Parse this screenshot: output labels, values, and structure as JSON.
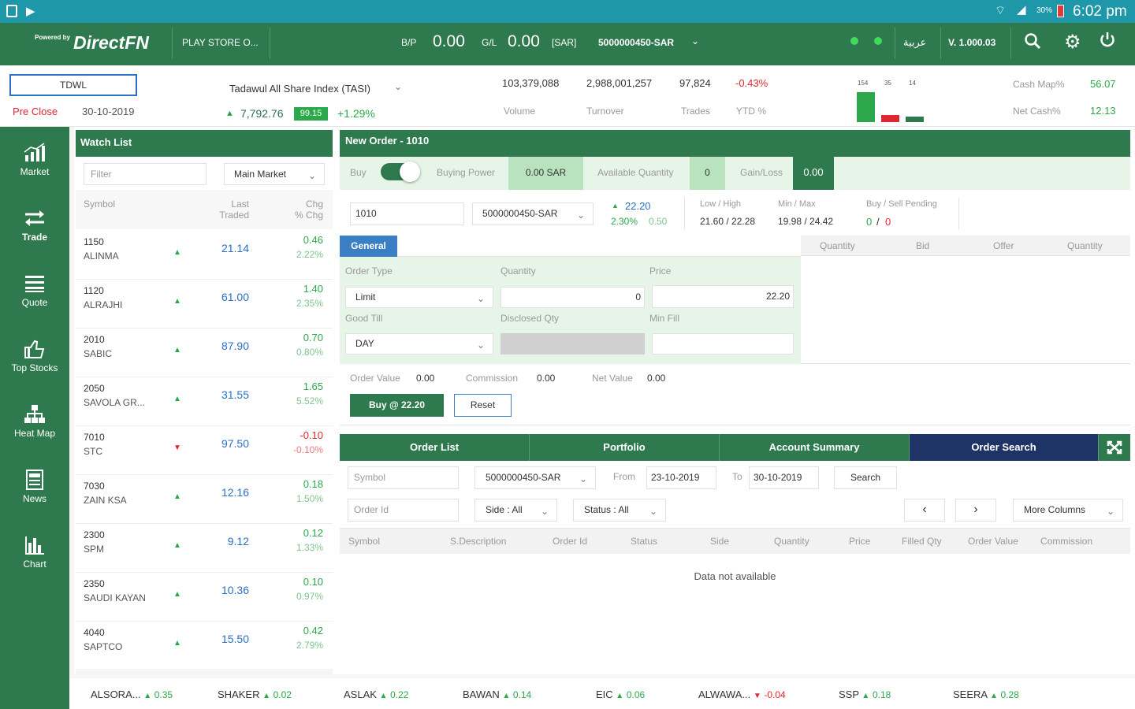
{
  "status_bar": {
    "battery_pct": "30%",
    "time": "6:02 pm"
  },
  "top_bar": {
    "logo": "DirectFN",
    "logo_prefix": "Powered by",
    "store_label": "PLAY STORE O...",
    "bp_label": "B/P",
    "bp_value": "0.00",
    "gl_label": "G/L",
    "gl_value": "0.00",
    "currency": "[SAR]",
    "account": "5000000450-SAR",
    "language": "عربية",
    "version": "V. 1.000.03"
  },
  "info_bar": {
    "symbol_box": "TDWL",
    "pre_close_label": "Pre Close",
    "date": "30-10-2019",
    "index_name": "Tadawul All Share Index (TASI)",
    "index_value": "7,792.76",
    "index_badge": "99.15",
    "index_change": "+1.29%",
    "volume_value": "103,379,088",
    "volume_label": "Volume",
    "turnover_value": "2,988,001,257",
    "turnover_label": "Turnover",
    "trades_value": "97,824",
    "trades_label": "Trades",
    "ytd_value": "-0.43%",
    "ytd_label": "YTD %",
    "mini_labels": [
      "154",
      "35",
      "14"
    ],
    "mini_bars": [
      154,
      35,
      14
    ],
    "cash_map_label": "Cash Map%",
    "cash_map_value": "56.07",
    "net_cash_label": "Net Cash%",
    "net_cash_value": "12.13"
  },
  "left_nav": [
    {
      "label": "Market",
      "icon": "bar-chart-icon"
    },
    {
      "label": "Trade",
      "icon": "swap-arrows-icon"
    },
    {
      "label": "Quote",
      "icon": "list-icon"
    },
    {
      "label": "Top Stocks",
      "icon": "thumbs-up-icon"
    },
    {
      "label": "Heat Map",
      "icon": "hierarchy-icon"
    },
    {
      "label": "News",
      "icon": "news-icon"
    },
    {
      "label": "Chart",
      "icon": "column-chart-icon"
    }
  ],
  "watch_list": {
    "title": "Watch List",
    "filter_placeholder": "Filter",
    "market_select": "Main Market",
    "col_symbol": "Symbol",
    "col_last_1": "Last",
    "col_last_2": "Traded",
    "col_chg_1": "Chg",
    "col_chg_2": "% Chg",
    "rows": [
      {
        "code": "1150",
        "name": "ALINMA",
        "dir": "up",
        "last": "21.14",
        "chg": "0.46",
        "pct": "2.22%"
      },
      {
        "code": "1120",
        "name": "ALRAJHI",
        "dir": "up",
        "last": "61.00",
        "chg": "1.40",
        "pct": "2.35%"
      },
      {
        "code": "2010",
        "name": "SABIC",
        "dir": "up",
        "last": "87.90",
        "chg": "0.70",
        "pct": "0.80%"
      },
      {
        "code": "2050",
        "name": "SAVOLA GR...",
        "dir": "up",
        "last": "31.55",
        "chg": "1.65",
        "pct": "5.52%"
      },
      {
        "code": "7010",
        "name": "STC",
        "dir": "down",
        "last": "97.50",
        "chg": "-0.10",
        "pct": "-0.10%"
      },
      {
        "code": "7030",
        "name": "ZAIN KSA",
        "dir": "up",
        "last": "12.16",
        "chg": "0.18",
        "pct": "1.50%"
      },
      {
        "code": "2300",
        "name": "SPM",
        "dir": "up",
        "last": "9.12",
        "chg": "0.12",
        "pct": "1.33%"
      },
      {
        "code": "2350",
        "name": "SAUDI KAYAN",
        "dir": "up",
        "last": "10.36",
        "chg": "0.10",
        "pct": "0.97%"
      },
      {
        "code": "4040",
        "name": "SAPTCO",
        "dir": "up",
        "last": "15.50",
        "chg": "0.42",
        "pct": "2.79%"
      }
    ]
  },
  "new_order": {
    "title": "New Order - 1010",
    "buy_label": "Buy",
    "buying_power_label": "Buying Power",
    "buying_power_value": "0.00 SAR",
    "avail_qty_label": "Available Quantity",
    "avail_qty_value": "0",
    "gain_loss_label": "Gain/Loss",
    "gain_loss_value": "0.00",
    "symbol_value": "1010",
    "account_value": "5000000450-SAR",
    "price_up": "22.20",
    "price_pct": "2.30%",
    "price_chg": "0.50",
    "low_high_label": "Low / High",
    "low_high_value": "21.60 / 22.28",
    "min_max_label": "Min / Max",
    "min_max_value": "19.98 / 24.42",
    "pending_label": "Buy / Sell Pending",
    "pending_buy": "0",
    "pending_sep": "/",
    "pending_sell": "0",
    "general_tab": "General",
    "depth_headers": [
      "Quantity",
      "Bid",
      "Offer",
      "Quantity"
    ],
    "order_type_label": "Order Type",
    "order_type_value": "Limit",
    "quantity_label": "Quantity",
    "quantity_value": "0",
    "price_label": "Price",
    "price_value": "22.20",
    "good_till_label": "Good Till",
    "good_till_value": "DAY",
    "disclosed_label": "Disclosed Qty",
    "min_fill_label": "Min Fill",
    "order_value_label": "Order Value",
    "order_value": "0.00",
    "commission_label": "Commission",
    "commission_value": "0.00",
    "net_value_label": "Net Value",
    "net_value": "0.00",
    "buy_button": "Buy @ 22.20",
    "reset_button": "Reset"
  },
  "order_panel": {
    "tabs": [
      "Order List",
      "Portfolio",
      "Account Summary",
      "Order Search"
    ],
    "symbol_placeholder": "Symbol",
    "account_value": "5000000450-SAR",
    "from_label": "From",
    "from_value": "23-10-2019",
    "to_label": "To",
    "to_value": "30-10-2019",
    "search_button": "Search",
    "order_id_placeholder": "Order Id",
    "side_value": "Side : All",
    "status_value": "Status : All",
    "prev": "‹",
    "next": "›",
    "more_columns": "More Columns",
    "columns": [
      "Symbol",
      "S.Description",
      "Order Id",
      "Status",
      "Side",
      "Quantity",
      "Price",
      "Filled Qty",
      "Order Value",
      "Commission"
    ],
    "empty_text": "Data not available"
  },
  "ticker": [
    {
      "name": "ALSORA...",
      "dir": "up",
      "chg": "0.35"
    },
    {
      "name": "SHAKER",
      "dir": "up",
      "chg": "0.02"
    },
    {
      "name": "ASLAK",
      "dir": "up",
      "chg": "0.22"
    },
    {
      "name": "BAWAN",
      "dir": "up",
      "chg": "0.14"
    },
    {
      "name": "EIC",
      "dir": "up",
      "chg": "0.06"
    },
    {
      "name": "ALWAWA...",
      "dir": "down",
      "chg": "-0.04"
    },
    {
      "name": "SSP",
      "dir": "up",
      "chg": "0.18"
    },
    {
      "name": "SEERA",
      "dir": "up",
      "chg": "0.28"
    }
  ],
  "colors": {
    "brand_green": "#2e7a4e",
    "status_teal": "#1e97a8",
    "up_green": "#2aa84a",
    "down_red": "#e0262f",
    "link_blue": "#2a6fc4",
    "active_tab": "#1f3466"
  }
}
